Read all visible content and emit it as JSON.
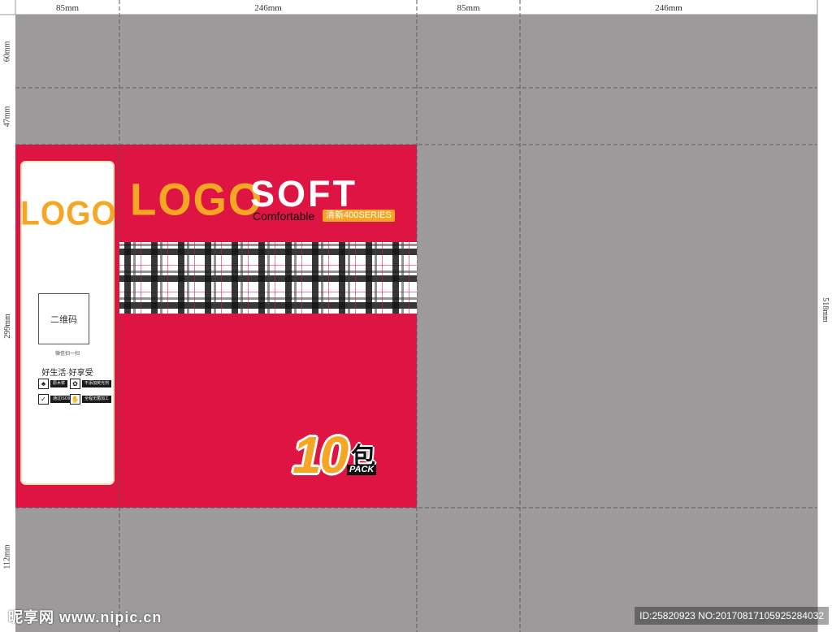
{
  "dimensions": {
    "top": [
      "85mm",
      "246mm",
      "85mm",
      "246mm"
    ],
    "left": [
      "60mm",
      "47mm",
      "299mm",
      "112mm"
    ],
    "right": "518mm"
  },
  "brand": {
    "logo": "LOGO",
    "product": "SOFT",
    "tagline": "Comfortable",
    "series": "清新400SERIES"
  },
  "side_panel": {
    "logo": "LOGO",
    "qr_label": "二维码",
    "qr_caption": "微信扫一扫",
    "slogan": "好生活·好享受",
    "certs": [
      {
        "icon": "tree-icon",
        "glyph": "♣",
        "text": "原木浆"
      },
      {
        "icon": "leaf-icon",
        "glyph": "✿",
        "text": "不添加荧光剂"
      },
      {
        "icon": "quality-icon",
        "glyph": "✓",
        "text": "通过ISO9001"
      },
      {
        "icon": "hand-icon",
        "glyph": "✋",
        "text": "全程无菌加工"
      }
    ]
  },
  "pack": {
    "count": "10",
    "unit": "包",
    "word": "PACK"
  },
  "watermark": {
    "site": "昵享网 www.nipic.cn",
    "id": "ID:25820923 NO:20170817105925284032"
  },
  "colors": {
    "panel": "#de1443",
    "sheet": "#9d9a9b",
    "accent": "#f5a623"
  }
}
